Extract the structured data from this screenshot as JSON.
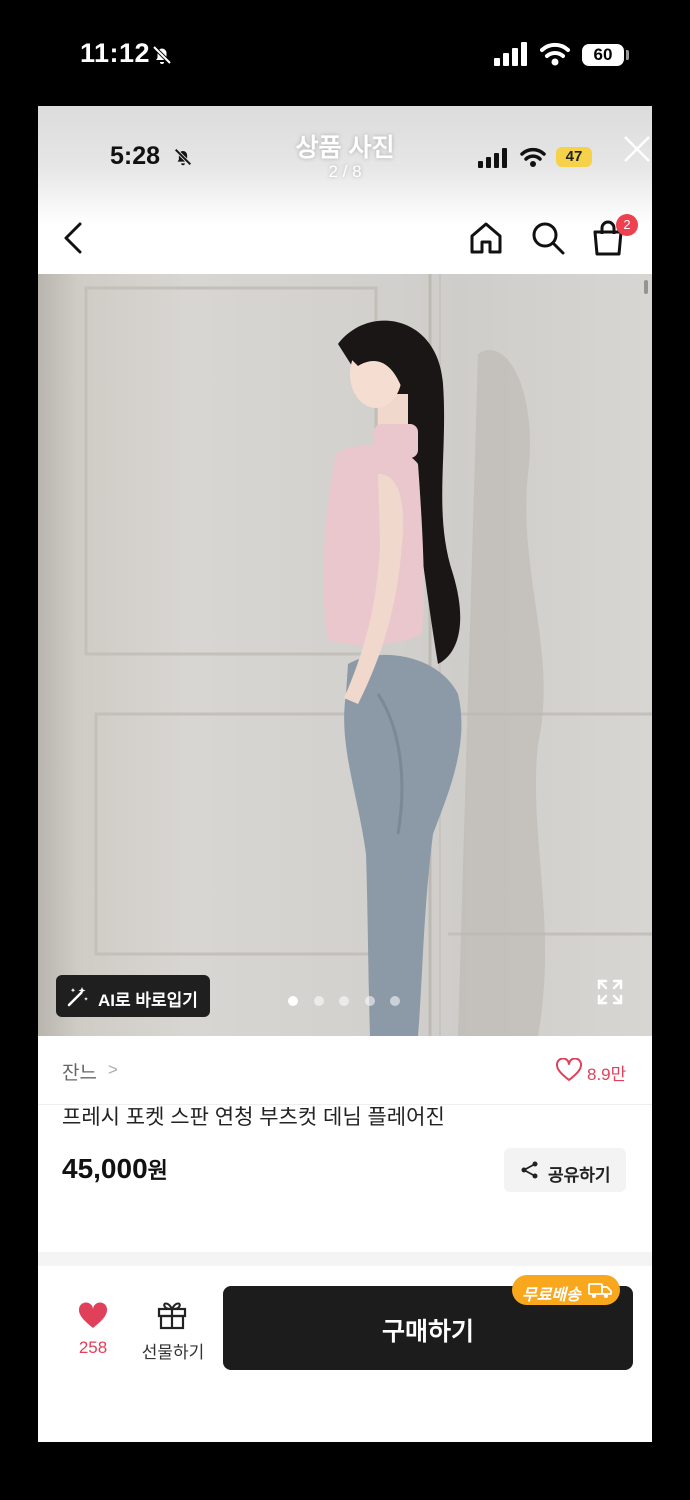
{
  "outer_status": {
    "time": "11:12",
    "battery": "60"
  },
  "inner_status": {
    "time": "5:28",
    "battery": "47"
  },
  "viewer": {
    "title": "상품 사진",
    "counter": "2 / 8"
  },
  "nav": {
    "cart_badge": "2"
  },
  "photo": {
    "ai_button_label": "AI로 바로입기",
    "page_indicator": {
      "total": 5,
      "active_index": 0
    }
  },
  "product": {
    "brand": "잔느",
    "brand_chevron": ">",
    "likes": "8.9만",
    "name": "프레시 포켓 스판 연청 부츠컷 데님 플레어진",
    "price": "45,000",
    "price_unit": "원",
    "share_label": "공유하기"
  },
  "bottom": {
    "wish_count": "258",
    "gift_label": "선물하기",
    "buy_label": "구매하기",
    "free_shipping_label": "무료배송"
  },
  "colors": {
    "accent_red": "#e0405a",
    "buy_button": "#1c1c1c",
    "free_ship": "#f9a81e",
    "cart_badge": "#ef4050"
  }
}
